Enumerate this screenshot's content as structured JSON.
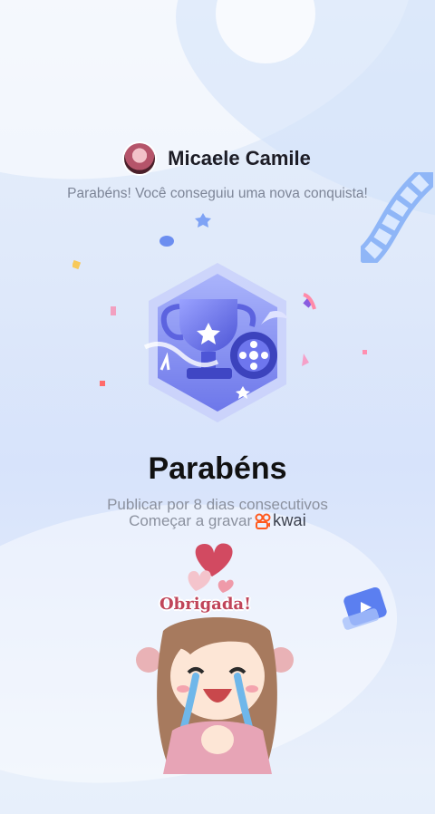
{
  "user": {
    "name": "Micaele Camile",
    "avatar_icon": "avatar-photo"
  },
  "achievement": {
    "subtitle": "Parabéns! Você conseguiu uma nova conquista!",
    "title": "Parabéns",
    "description": "Publicar por 8 dias consecutivos",
    "badge_icon": "trophy-film-badge"
  },
  "cta": {
    "label": "Começar a gravar",
    "brand": "kwai",
    "brand_color": "#ff5a1f"
  },
  "sticker": {
    "label": "Obrigada!"
  },
  "colors": {
    "badge_primary": "#7d86f2",
    "badge_dark": "#4b52c9",
    "heart": "#d24a61",
    "text_dark": "#111111",
    "text_muted": "#8b919f"
  }
}
